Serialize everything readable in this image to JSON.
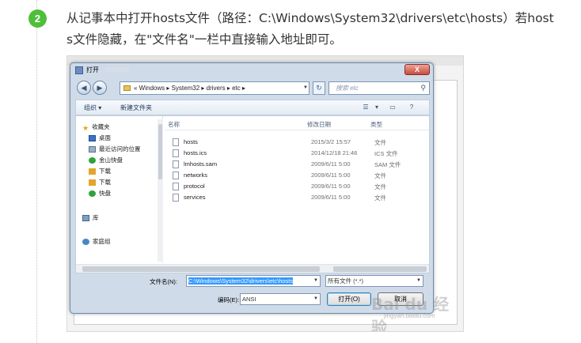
{
  "step": {
    "number": "2",
    "text_line1": "从记事本中打开hosts文件（路径：C:\\Windows\\System32\\drivers\\etc\\hosts）若host",
    "text_line2": "s文件隐藏，在\"文件名\"一栏中直接输入地址即可。"
  },
  "dialog": {
    "title": "打开",
    "close": "X",
    "nav": {
      "back": "◀",
      "forward": "▶",
      "breadcrumb": "« Windows ▸ System32 ▸ drivers ▸ etc ▸",
      "refresh": "↻",
      "search_placeholder": "搜索 etc"
    },
    "toolbar": {
      "organize": "组织 ▾",
      "new_folder": "新建文件夹"
    },
    "sidebar": {
      "items": [
        {
          "label": "收藏夹",
          "icon": "star-icon"
        },
        {
          "label": "桌面",
          "icon": "desktop-icon"
        },
        {
          "label": "最近访问的位置",
          "icon": "recent-places-icon"
        },
        {
          "label": "金山快盘",
          "icon": "kuaipan-icon"
        },
        {
          "label": "下载",
          "icon": "download-icon"
        },
        {
          "label": "下载",
          "icon": "download-icon"
        },
        {
          "label": "快盘",
          "icon": "kuaipan-icon"
        },
        {
          "label": "库",
          "icon": "library-icon"
        },
        {
          "label": "家庭组",
          "icon": "homegroup-icon"
        }
      ]
    },
    "columns": {
      "name": "名称",
      "date": "修改日期",
      "type": "类型"
    },
    "files": [
      {
        "name": "hosts",
        "date": "2015/3/2 15:57",
        "type": "文件"
      },
      {
        "name": "hosts.ics",
        "date": "2014/12/18 21:46",
        "type": "ICS 文件"
      },
      {
        "name": "lmhosts.sam",
        "date": "2009/6/11 5:00",
        "type": "SAM 文件"
      },
      {
        "name": "networks",
        "date": "2009/6/11 5:00",
        "type": "文件"
      },
      {
        "name": "protocol",
        "date": "2009/6/11 5:00",
        "type": "文件"
      },
      {
        "name": "services",
        "date": "2009/6/11 5:00",
        "type": "文件"
      }
    ],
    "filename_label": "文件名(N):",
    "filename_value": "C:\\Windows\\System32\\drivers\\etc\\hosts",
    "filetype_value": "所有文件 (*.*)",
    "encoding_label": "编码(E):",
    "encoding_value": "ANSI",
    "open_button": "打开(O)",
    "cancel_button": "取消"
  },
  "watermark": {
    "brand": "Bai du 经验",
    "url": "jingyan.baidu.com"
  },
  "colors": {
    "step_badge": "#4fbf3a",
    "selection": "#3399ff",
    "dialog_frame": "#cfdbe9"
  }
}
